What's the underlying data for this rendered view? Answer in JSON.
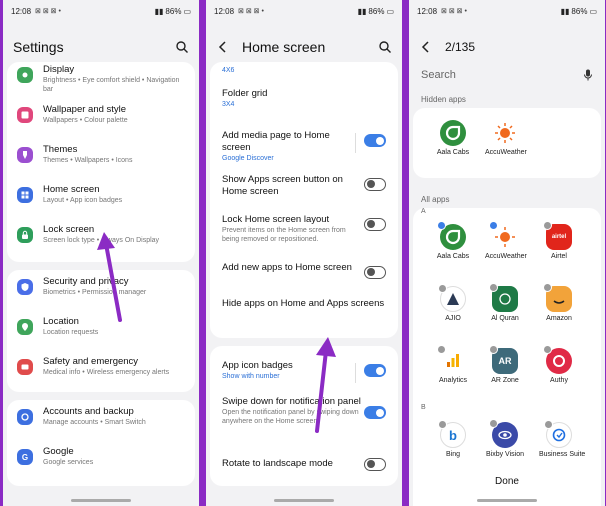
{
  "status": {
    "time": "12:08",
    "battery": "86%"
  },
  "panel1": {
    "title": "Settings",
    "items": [
      {
        "title": "Display",
        "desc": "Brightness  •  Eye comfort shield  •  Navigation bar",
        "color": "#3fa55b"
      },
      {
        "title": "Wallpaper and style",
        "desc": "Wallpapers  •  Colour palette",
        "color": "#e0477c"
      },
      {
        "title": "Themes",
        "desc": "Themes  •  Wallpapers  •  Icons",
        "color": "#9b4fd0"
      },
      {
        "title": "Home screen",
        "desc": "Layout  •  App icon badges",
        "color": "#3d6fe0"
      },
      {
        "title": "Lock screen",
        "desc": "Screen lock type  •  Always On Display",
        "color": "#2e9e5b"
      },
      {
        "title": "Security and privacy",
        "desc": "Biometrics  •  Permission manager",
        "color": "#4a6ee8"
      },
      {
        "title": "Location",
        "desc": "Location requests",
        "color": "#3fa55b"
      },
      {
        "title": "Safety and emergency",
        "desc": "Medical info  •  Wireless emergency alerts",
        "color": "#e04b4b"
      },
      {
        "title": "Accounts and backup",
        "desc": "Manage accounts  •  Smart Switch",
        "color": "#3d6fe0"
      },
      {
        "title": "Google",
        "desc": "Google services",
        "color": "#3d6fe0"
      }
    ]
  },
  "panel2": {
    "title": "Home screen",
    "top_value": "4X6",
    "folder_grid": {
      "title": "Folder grid",
      "value": "3X4"
    },
    "items": [
      {
        "title": "Add media page to Home screen",
        "desc": "",
        "blue": "Google Discover",
        "toggle": "on"
      },
      {
        "title": "Show Apps screen button on Home screen",
        "desc": "",
        "blue": "",
        "toggle": "off"
      },
      {
        "title": "Lock Home screen layout",
        "desc": "Prevent items on the Home screen from being removed or repositioned.",
        "blue": "",
        "toggle": "off"
      },
      {
        "title": "Add new apps to Home screen",
        "desc": "",
        "blue": "",
        "toggle": "off"
      },
      {
        "title": "Hide apps on Home and Apps screens",
        "desc": "",
        "blue": "",
        "toggle": "none"
      }
    ],
    "items2": [
      {
        "title": "App icon badges",
        "desc": "",
        "blue": "Show with number",
        "toggle": "on"
      },
      {
        "title": "Swipe down for notification panel",
        "desc": "Open the notification panel by swiping down anywhere on the Home screen.",
        "blue": "",
        "toggle": "on"
      },
      {
        "title": "Rotate to landscape mode",
        "desc": "",
        "blue": "",
        "toggle": "off"
      }
    ]
  },
  "panel3": {
    "counter": "2/135",
    "search_placeholder": "Search",
    "hidden_label": "Hidden apps",
    "all_label": "All apps",
    "letter_a": "A",
    "letter_b": "B",
    "hidden_apps": [
      {
        "name": "Aala Cabs",
        "color": "#2f8f3e"
      },
      {
        "name": "AccuWeather",
        "color": "#f06a1f"
      }
    ],
    "all_apps": [
      {
        "name": "Aala Cabs",
        "color": "#2f8f3e",
        "checked": true
      },
      {
        "name": "AccuWeather",
        "color": "#f06a1f",
        "checked": true
      },
      {
        "name": "Airtel",
        "color": "#e1251b",
        "checked": false
      },
      {
        "name": "AJIO",
        "color": "#2b3a55",
        "checked": false
      },
      {
        "name": "Al Quran",
        "color": "#1e7a46",
        "checked": false
      },
      {
        "name": "Amazon",
        "color": "#f2a33a",
        "checked": false
      },
      {
        "name": "Analytics",
        "color": "#f5b400",
        "checked": false
      },
      {
        "name": "AR Zone",
        "color": "#3e6a7a",
        "checked": false
      },
      {
        "name": "Authy",
        "color": "#e02a46",
        "checked": false
      },
      {
        "name": "Bing",
        "color": "#1b76d2",
        "checked": false
      },
      {
        "name": "Bixby Vision",
        "color": "#3b4aa8",
        "checked": false
      },
      {
        "name": "Business Suite",
        "color": "#1f6fe0",
        "checked": false
      }
    ],
    "done_label": "Done"
  }
}
